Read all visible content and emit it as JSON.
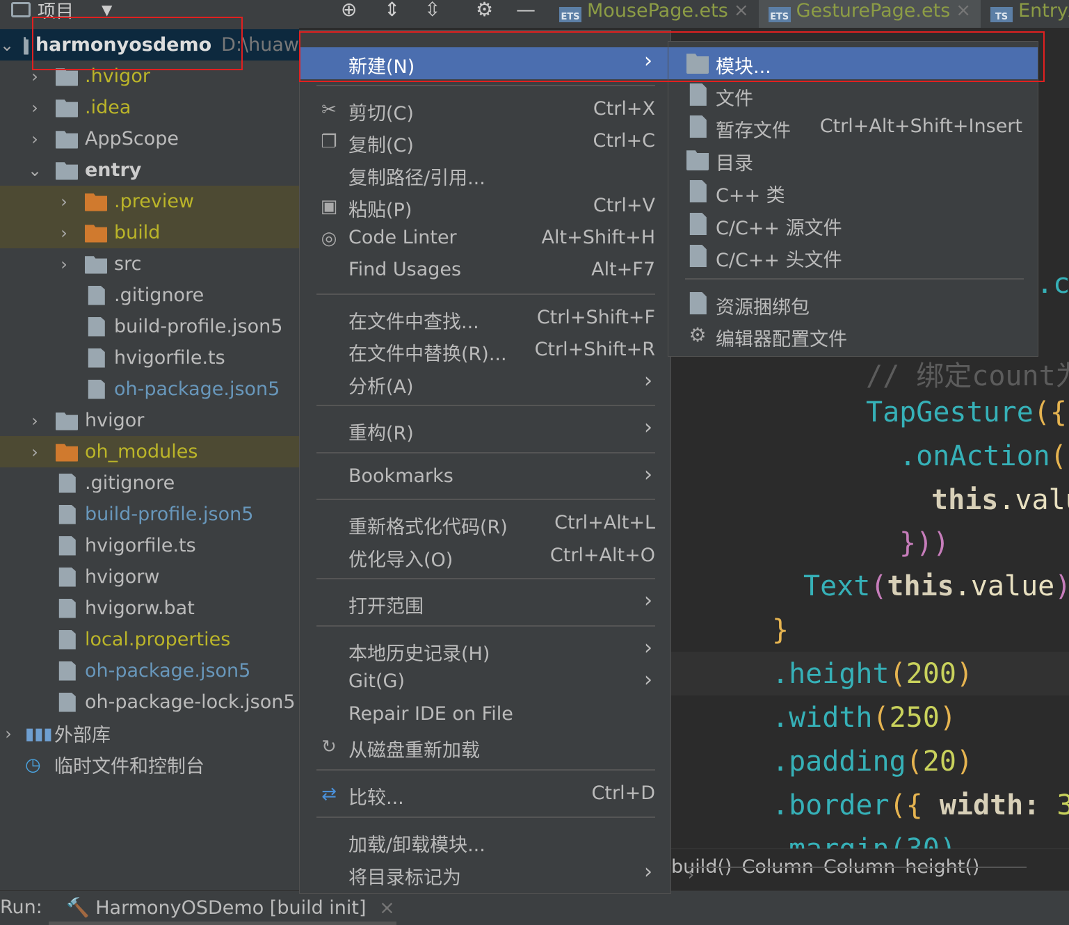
{
  "toolbar": {
    "project_label": "项目",
    "tabs": [
      {
        "badge": "ETS",
        "name": "MousePage.ets"
      },
      {
        "badge": "ETS",
        "name": "GesturePage.ets"
      },
      {
        "badge": "TS",
        "name": "EntryAl"
      }
    ]
  },
  "tree": {
    "root_name": "harmonyosdemo",
    "root_path": "D:\\huaw",
    "items": [
      {
        "label": ".hvigor"
      },
      {
        "label": ".idea"
      },
      {
        "label": "AppScope"
      },
      {
        "label": "entry"
      },
      {
        "label": ".preview"
      },
      {
        "label": "build"
      },
      {
        "label": "src"
      },
      {
        "label": ".gitignore"
      },
      {
        "label": "build-profile.json5"
      },
      {
        "label": "hvigorfile.ts"
      },
      {
        "label": "oh-package.json5"
      },
      {
        "label": "hvigor"
      },
      {
        "label": "oh_modules"
      },
      {
        "label": ".gitignore"
      },
      {
        "label": "build-profile.json5"
      },
      {
        "label": "hvigorfile.ts"
      },
      {
        "label": "hvigorw"
      },
      {
        "label": "hvigorw.bat"
      },
      {
        "label": "local.properties"
      },
      {
        "label": "oh-package.json5"
      },
      {
        "label": "oh-package-lock.json5"
      },
      {
        "label": "外部库"
      },
      {
        "label": "临时文件和控制台"
      }
    ]
  },
  "menu": {
    "items": [
      {
        "label": "新建(N)",
        "shortcut": ""
      },
      {
        "label": "剪切(C)",
        "shortcut": "Ctrl+X"
      },
      {
        "label": "复制(C)",
        "shortcut": "Ctrl+C"
      },
      {
        "label": "复制路径/引用...",
        "shortcut": ""
      },
      {
        "label": "粘贴(P)",
        "shortcut": "Ctrl+V"
      },
      {
        "label": "Code Linter",
        "shortcut": "Alt+Shift+H"
      },
      {
        "label": "Find Usages",
        "shortcut": "Alt+F7"
      },
      {
        "label": "在文件中查找...",
        "shortcut": "Ctrl+Shift+F"
      },
      {
        "label": "在文件中替换(R)...",
        "shortcut": "Ctrl+Shift+R"
      },
      {
        "label": "分析(A)",
        "shortcut": ""
      },
      {
        "label": "重构(R)",
        "shortcut": ""
      },
      {
        "label": "Bookmarks",
        "shortcut": ""
      },
      {
        "label": "重新格式化代码(R)",
        "shortcut": "Ctrl+Alt+L"
      },
      {
        "label": "优化导入(O)",
        "shortcut": "Ctrl+Alt+O"
      },
      {
        "label": "打开范围",
        "shortcut": ""
      },
      {
        "label": "本地历史记录(H)",
        "shortcut": ""
      },
      {
        "label": "Git(G)",
        "shortcut": ""
      },
      {
        "label": "Repair IDE on File",
        "shortcut": ""
      },
      {
        "label": "从磁盘重新加载",
        "shortcut": ""
      },
      {
        "label": "比较...",
        "shortcut": "Ctrl+D"
      },
      {
        "label": "加载/卸载模块...",
        "shortcut": ""
      },
      {
        "label": "将目录标记为",
        "shortcut": ""
      }
    ]
  },
  "submenu": {
    "items": [
      {
        "label": "模块...",
        "shortcut": ""
      },
      {
        "label": "文件",
        "shortcut": ""
      },
      {
        "label": "暂存文件",
        "shortcut": "Ctrl+Alt+Shift+Insert"
      },
      {
        "label": "目录",
        "shortcut": ""
      },
      {
        "label": "C++ 类",
        "shortcut": ""
      },
      {
        "label": "C/C++ 源文件",
        "shortcut": ""
      },
      {
        "label": "C/C++ 头文件",
        "shortcut": ""
      },
      {
        "label": "资源捆绑包",
        "shortcut": ""
      },
      {
        "label": "编辑器配置文件",
        "shortcut": ""
      }
    ]
  },
  "editor": {
    "l0": ".ce",
    "l1_slashes": "//",
    "l1_text": "绑定count为",
    "l2_fn": "TapGesture",
    "l2_p": "({",
    "l3_fn": ".onAction",
    "l3_p": "((",
    "l4_kw": "this",
    "l4_rest": ".valu",
    "l5": "}))",
    "l6_fn": "Text",
    "l6_p1": "(",
    "l6_kw": "this",
    "l6_rest": ".value",
    "l6_p2": ")",
    "l7": "}",
    "l8_fn": ".height",
    "l8_p1": "(",
    "l8_num": "200",
    "l8_p2": ")",
    "l9_fn": ".width",
    "l9_p1": "(",
    "l9_num": "250",
    "l9_p2": ")",
    "l10_fn": ".padding",
    "l10_p1": "(",
    "l10_num": "20",
    "l10_p2": ")",
    "l11_fn": ".border",
    "l11_p": "({",
    "l11_key": " width:",
    "l11_num": " 3",
    "l12": ".margin(30)"
  },
  "breadcrumbs": [
    "build()",
    "Column",
    "Column",
    "height()"
  ],
  "run": {
    "label": "Run:",
    "task": "HarmonyOSDemo [build init]"
  },
  "colors": {
    "accent": "#4b6eaf",
    "annotation": "#e02020"
  }
}
